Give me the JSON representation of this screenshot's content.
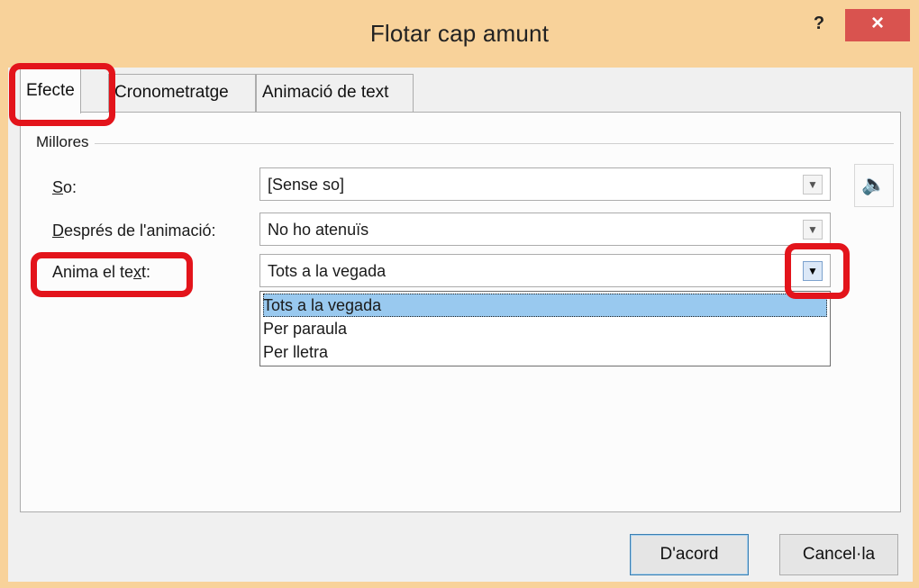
{
  "window": {
    "title": "Flotar cap amunt",
    "help_glyph": "?",
    "close_glyph": "×"
  },
  "tabs": [
    {
      "label": "Efecte",
      "active": true
    },
    {
      "label": "Cronometratge",
      "active": false
    },
    {
      "label": "Animació de text",
      "active": false
    }
  ],
  "group": {
    "label": "Millores"
  },
  "fields": {
    "sound": {
      "label": "So:",
      "value": "[Sense so]"
    },
    "after_animation": {
      "label": "Després de l'animació:",
      "value": "No ho atenuïs"
    },
    "animate_text": {
      "label": "Anima el text:",
      "value": "Tots a la vegada"
    }
  },
  "dropdown_options": [
    "Tots a la vegada",
    "Per paraula",
    "Per lletra"
  ],
  "selected_option": "Tots a la vegada",
  "icons": {
    "sound": "speaker-icon",
    "arrow": "chevron-down-icon"
  },
  "buttons": {
    "ok": "D'acord",
    "cancel": "Cancel·la"
  },
  "colors": {
    "title_bar": "#f8d29a",
    "close_button": "#d9534f",
    "selection": "#99c9ef",
    "highlight_marks": "#e3141b"
  }
}
